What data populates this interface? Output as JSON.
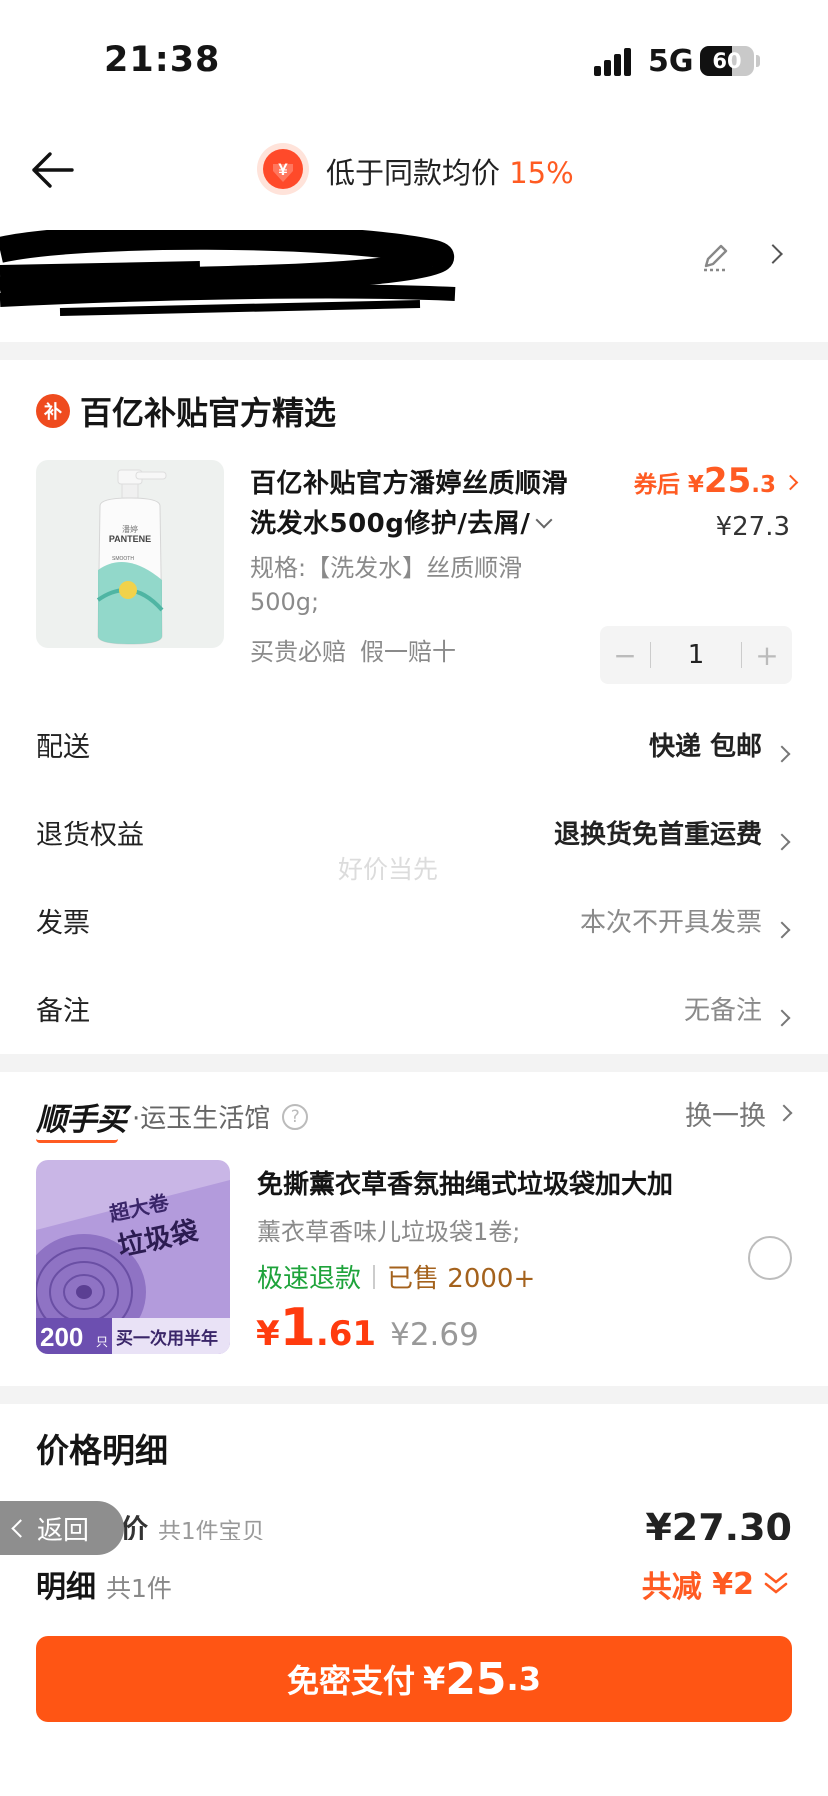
{
  "status_bar": {
    "time": "21:38",
    "network": "5G",
    "battery": "60",
    "battery_level": 0.6
  },
  "header": {
    "badge_symbol": "¥",
    "text": "低于同款均价",
    "percent": "15%"
  },
  "shop": {
    "icon_char": "补",
    "name": "百亿补贴官方精选"
  },
  "product": {
    "title": "百亿补贴官方潘婷丝质顺滑洗发水500g修护/去屑/",
    "spec": "规格:【洗发水】丝质顺滑500g;",
    "guarantees": [
      "买贵必赔",
      "假一赔十"
    ],
    "price_after_label": "券后",
    "price_after_symbol": "¥",
    "price_after_int": "25",
    "price_after_dec": ".3",
    "price_original": "¥27.3",
    "quantity": "1",
    "stepper_minus": "−",
    "stepper_plus": "+",
    "brand_text": "PANTENE",
    "brand_cn": "潘婷",
    "bottle_label": "SMOOTH"
  },
  "rows": [
    {
      "label": "配送",
      "value": "快递 包邮"
    },
    {
      "label": "退货权益",
      "value": "退换货免首重运费"
    },
    {
      "label": "发票",
      "value": "本次不开具发票"
    },
    {
      "label": "备注",
      "value": "无备注"
    }
  ],
  "watermark": "好价当先",
  "shunshoumai": {
    "logo": "顺手买",
    "store": "·运玉生活馆",
    "help_icon": "?",
    "swap_label": "换一换",
    "item": {
      "title": "免撕薰衣草香氛抽绳式垃圾袋加大加",
      "spec": "薰衣草香味儿垃圾袋1卷;",
      "tag_refund": "极速退款",
      "tag_sold": "已售 2000+",
      "price_symbol": "¥",
      "price_int": "1",
      "price_dec": ".61",
      "price_original": "¥2.69",
      "img_text_top": "超大卷",
      "img_text_main": "垃圾袋",
      "img_count": "200",
      "img_unit": "只",
      "img_slogan": "买一次用半年"
    }
  },
  "price_detail": {
    "title": "价格明细",
    "total_label": "商品总价",
    "total_count": "共1件宝贝",
    "total_value": "¥27.30"
  },
  "back_pill": "返回",
  "footer": {
    "detail_label": "明细",
    "detail_count": "共1件",
    "reduce_label": "共减",
    "reduce_value": "¥2",
    "pay_label": "免密支付",
    "pay_symbol": "¥",
    "pay_int": "25",
    "pay_dec": ".3"
  },
  "colors": {
    "accent": "#ff5514",
    "green": "#1ea33b",
    "sold": "#a4621d"
  }
}
